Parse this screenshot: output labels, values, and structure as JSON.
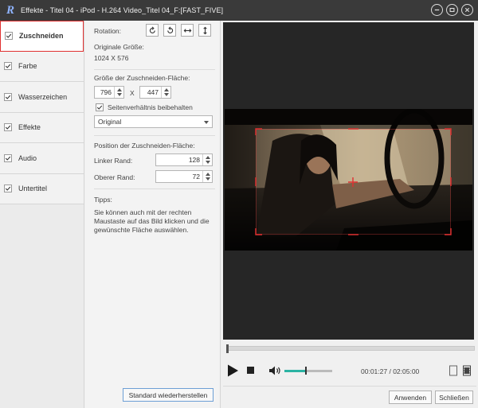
{
  "window": {
    "title": "Effekte - Titel 04 - iPod - H.264 Video_Titel 04_F:[FAST_FIVE]",
    "logo_letter": "R"
  },
  "sidebar": {
    "items": [
      {
        "label": "Zuschneiden",
        "checked": true,
        "active": true
      },
      {
        "label": "Farbe",
        "checked": true,
        "active": false
      },
      {
        "label": "Wasserzeichen",
        "checked": true,
        "active": false
      },
      {
        "label": "Effekte",
        "checked": true,
        "active": false
      },
      {
        "label": "Audio",
        "checked": true,
        "active": false
      },
      {
        "label": "Untertitel",
        "checked": true,
        "active": false
      }
    ]
  },
  "settings": {
    "rotation_label": "Rotation:",
    "original_size_label": "Originale Größe:",
    "original_size_value": "1024 X 576",
    "crop_area_size_label": "Größe der Zuschneiden-Fläche:",
    "width_value": "796",
    "x_separator": "X",
    "height_value": "447",
    "keep_ratio_label": "Seitenverhältnis beibehalten",
    "keep_ratio_checked": true,
    "ratio_select_value": "Original",
    "crop_position_label": "Position der Zuschneiden-Fläche:",
    "left_margin_label": "Linker Rand:",
    "left_margin_value": "128",
    "top_margin_label": "Oberer Rand:",
    "top_margin_value": "72",
    "tips_label": "Tipps:",
    "tips_text": "Sie können auch mit der rechten Maustaste auf das Bild klicken und die gewünschte Fläche auswählen.",
    "reset_button": "Standard wiederherstellen"
  },
  "player": {
    "time_current": "00:01:27",
    "time_separator": " / ",
    "time_total": "02:05:00",
    "seek_progress": 0.01,
    "volume_level": 0.45
  },
  "footer": {
    "apply_button": "Anwenden",
    "close_button": "Schließen"
  },
  "colors": {
    "accent_red": "#e03030",
    "volume_fill": "#2bb3a3",
    "title_bar": "#3a3a3a"
  }
}
